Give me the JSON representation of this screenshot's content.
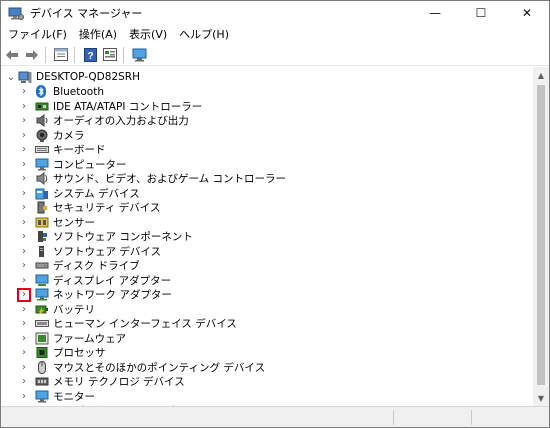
{
  "window": {
    "title": "デバイス マネージャー",
    "minimize_glyph": "—",
    "maximize_glyph": "☐",
    "close_glyph": "✕"
  },
  "menu": [
    {
      "label": "ファイル(F)"
    },
    {
      "label": "操作(A)"
    },
    {
      "label": "表示(V)"
    },
    {
      "label": "ヘルプ(H)"
    }
  ],
  "toolbar": {
    "buttons": [
      "back-icon",
      "forward-icon",
      "properties-icon",
      "help-icon",
      "view-icon",
      "monitor-icon"
    ]
  },
  "tree": {
    "root": {
      "label": "DESKTOP-QD82SRH",
      "icon": "computer-icon",
      "expanded": true
    },
    "items": [
      {
        "label": "Bluetooth",
        "icon": "bluetooth-icon"
      },
      {
        "label": "IDE ATA/ATAPI コントローラー",
        "icon": "ide-controller-icon"
      },
      {
        "label": "オーディオの入力および出力",
        "icon": "speaker-icon"
      },
      {
        "label": "カメラ",
        "icon": "camera-icon"
      },
      {
        "label": "キーボード",
        "icon": "keyboard-icon"
      },
      {
        "label": "コンピューター",
        "icon": "computer-icon"
      },
      {
        "label": "サウンド、ビデオ、およびゲーム コントローラー",
        "icon": "sound-icon"
      },
      {
        "label": "システム デバイス",
        "icon": "system-device-icon"
      },
      {
        "label": "セキュリティ デバイス",
        "icon": "security-device-icon"
      },
      {
        "label": "センサー",
        "icon": "sensor-icon"
      },
      {
        "label": "ソフトウェア コンポーネント",
        "icon": "software-component-icon"
      },
      {
        "label": "ソフトウェア デバイス",
        "icon": "software-device-icon"
      },
      {
        "label": "ディスク ドライブ",
        "icon": "disk-drive-icon"
      },
      {
        "label": "ディスプレイ アダプター",
        "icon": "display-adapter-icon"
      },
      {
        "label": "ネットワーク アダプター",
        "icon": "network-adapter-icon",
        "highlighted": true
      },
      {
        "label": "バッテリ",
        "icon": "battery-icon"
      },
      {
        "label": "ヒューマン インターフェイス デバイス",
        "icon": "hid-icon"
      },
      {
        "label": "ファームウェア",
        "icon": "firmware-icon"
      },
      {
        "label": "プロセッサ",
        "icon": "processor-icon"
      },
      {
        "label": "マウスとそのほかのポインティング デバイス",
        "icon": "mouse-icon"
      },
      {
        "label": "メモリ テクノロジ デバイス",
        "icon": "memory-icon"
      },
      {
        "label": "モニター",
        "icon": "monitor-icon"
      },
      {
        "label": "ユニバーサル シリアル バス コントローラー",
        "icon": "usb-icon"
      }
    ]
  },
  "colors": {
    "highlight_border": "#e0001b",
    "icon_blue": "#1e72c6",
    "icon_green": "#3a8a2e",
    "icon_gray": "#6b6b6b"
  }
}
